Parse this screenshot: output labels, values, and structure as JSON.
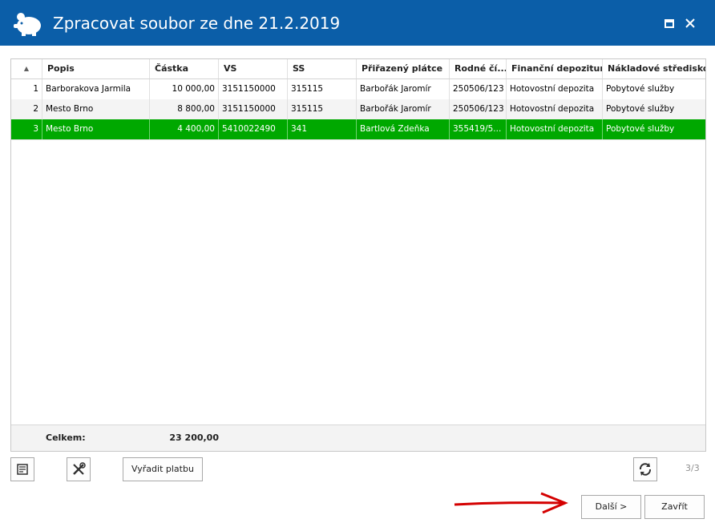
{
  "window": {
    "title": "Zpracovat soubor ze dne 21.2.2019",
    "accent_color": "#0b5ea8",
    "icons": {
      "app": "piggy-bank-icon",
      "maximize": "maximize-icon",
      "close": "close-icon"
    }
  },
  "grid": {
    "sort_indicator": "▲",
    "columns": [
      "Popis",
      "Částka",
      "VS",
      "SS",
      "Přiřazený plátce",
      "Rodné čí...",
      "Finanční depozitum",
      "Nákladové středisko"
    ],
    "rows": [
      {
        "n": "1",
        "popis": "Barborakova Jarmila",
        "castka": "10 000,00",
        "vs": "3151150000",
        "ss": "315115",
        "platce": "Barbořák Jaromír",
        "rc": "250506/123",
        "depozitum": "Hotovostní depozita",
        "stredisko": "Pobytové služby"
      },
      {
        "n": "2",
        "popis": "Mesto Brno",
        "castka": "8 800,00",
        "vs": "3151150000",
        "ss": "315115",
        "platce": "Barbořák Jaromír",
        "rc": "250506/123",
        "depozitum": "Hotovostní depozita",
        "stredisko": "Pobytové služby"
      },
      {
        "n": "3",
        "popis": "Mesto Brno",
        "castka": "4 400,00",
        "vs": "5410022490",
        "ss": "341",
        "platce": "Bartlová Zdeňka",
        "rc": "355419/5...",
        "depozitum": "Hotovostní depozita",
        "stredisko": "Pobytové služby"
      }
    ],
    "selected_row": 3,
    "selected_color": "#00a800",
    "footer": {
      "label": "Celkem:",
      "total": "23 200,00"
    }
  },
  "toolbar": {
    "notes_icon": "notes-icon",
    "tools_icon": "tools-icon",
    "remove_label": "Vyřadit platbu",
    "refresh_icon": "refresh-icon",
    "page_count": "3/3"
  },
  "actions": {
    "next_label": "Další >",
    "close_label": "Zavřít",
    "arrow_color": "#d40000"
  }
}
